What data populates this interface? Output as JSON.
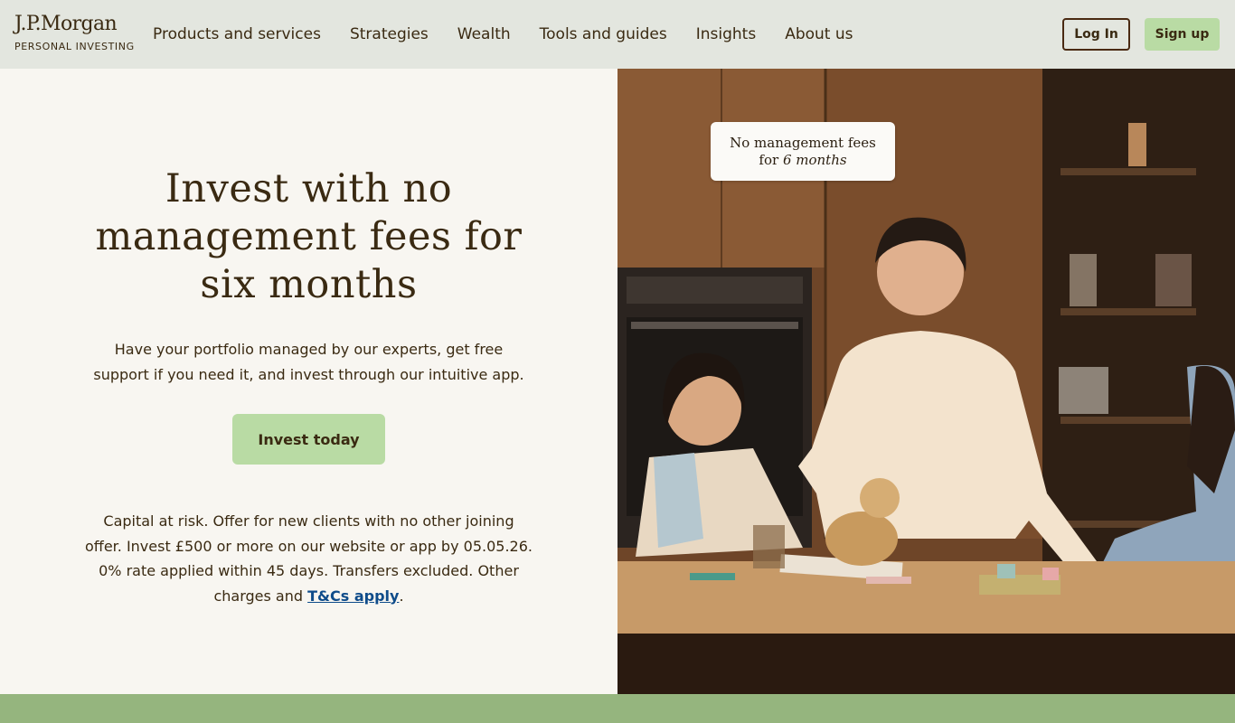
{
  "header": {
    "logo": {
      "main": "J.P.Morgan",
      "sub": "PERSONAL INVESTING"
    },
    "nav": [
      "Products and services",
      "Strategies",
      "Wealth",
      "Tools and guides",
      "Insights",
      "About us"
    ],
    "login_label": "Log In",
    "signup_label": "Sign up"
  },
  "hero": {
    "title_lines": [
      "Invest with no",
      "management fees for",
      "six months"
    ],
    "subtitle_lines": [
      "Have your portfolio managed by our experts, get free",
      "support if you need it, and invest through our intuitive app."
    ],
    "cta_label": "Invest today",
    "disclaimer_lines": [
      "Capital at risk. Offer for new clients with no other joining",
      "offer. Invest £500 or more on our website or app by 05.05.26.",
      "0% rate applied within 45 days. Transfers excluded. Other"
    ],
    "disclaimer_last_prefix": "charges and ",
    "disclaimer_link": "T&Cs apply",
    "disclaimer_last_suffix": "."
  },
  "promo_badge": {
    "line1": "No management fees",
    "line2_prefix": "for ",
    "line2_emphasis": "6 months"
  },
  "colors": {
    "accent_green": "#b9dba4",
    "band_green": "#95b57e",
    "text_brown": "#3a2a12",
    "link_blue": "#0f4c8a"
  }
}
